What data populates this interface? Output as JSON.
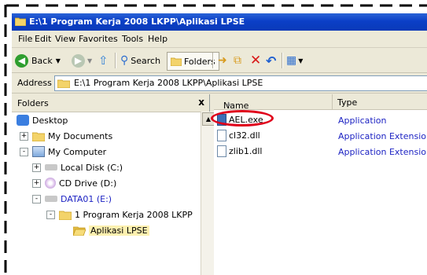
{
  "window": {
    "title": "E:\\1 Program Kerja 2008 LKPP\\Aplikasi LPSE"
  },
  "menu": [
    "File",
    "Edit",
    "View",
    "Favorites",
    "Tools",
    "Help"
  ],
  "toolbar": {
    "back_label": "Back",
    "search_label": "Search",
    "folders_label": "Folders"
  },
  "address": {
    "label": "Address",
    "value": "E:\\1 Program Kerja 2008 LKPP\\Aplikasi LPSE"
  },
  "folders_pane": {
    "title": "Folders",
    "close_label": "x",
    "tree": [
      {
        "label": "Desktop",
        "icon": "desktop-icon"
      },
      {
        "label": "My Documents",
        "icon": "folder-icon",
        "expander": "+"
      },
      {
        "label": "My Computer",
        "icon": "computer-icon",
        "expander": "-"
      },
      {
        "label": "Local Disk (C:)",
        "icon": "drive-icon",
        "expander": "+"
      },
      {
        "label": "CD Drive (D:)",
        "icon": "cd-drive-icon",
        "expander": "+"
      },
      {
        "label": "DATA01 (E:)",
        "icon": "drive-icon",
        "expander": "-"
      },
      {
        "label": "1 Program Kerja 2008 LKPP",
        "icon": "folder-icon",
        "expander": "-"
      },
      {
        "label": "Aplikasi LPSE",
        "icon": "open-folder-icon",
        "selected": true
      }
    ]
  },
  "file_list": {
    "columns": [
      "Name",
      "Type"
    ],
    "rows": [
      {
        "name": "AEL.exe",
        "type": "Application",
        "icon": "exe-icon",
        "highlighted": true
      },
      {
        "name": "cl32.dll",
        "type": "Application Extension",
        "icon": "dll-icon"
      },
      {
        "name": "zlib1.dll",
        "type": "Application Extension",
        "icon": "dll-icon"
      }
    ]
  },
  "colors": {
    "titlebar": "#0b3fc7",
    "highlight_ring": "#e0001b",
    "type_text": "#1d23c3",
    "selection": "#316ac5"
  }
}
